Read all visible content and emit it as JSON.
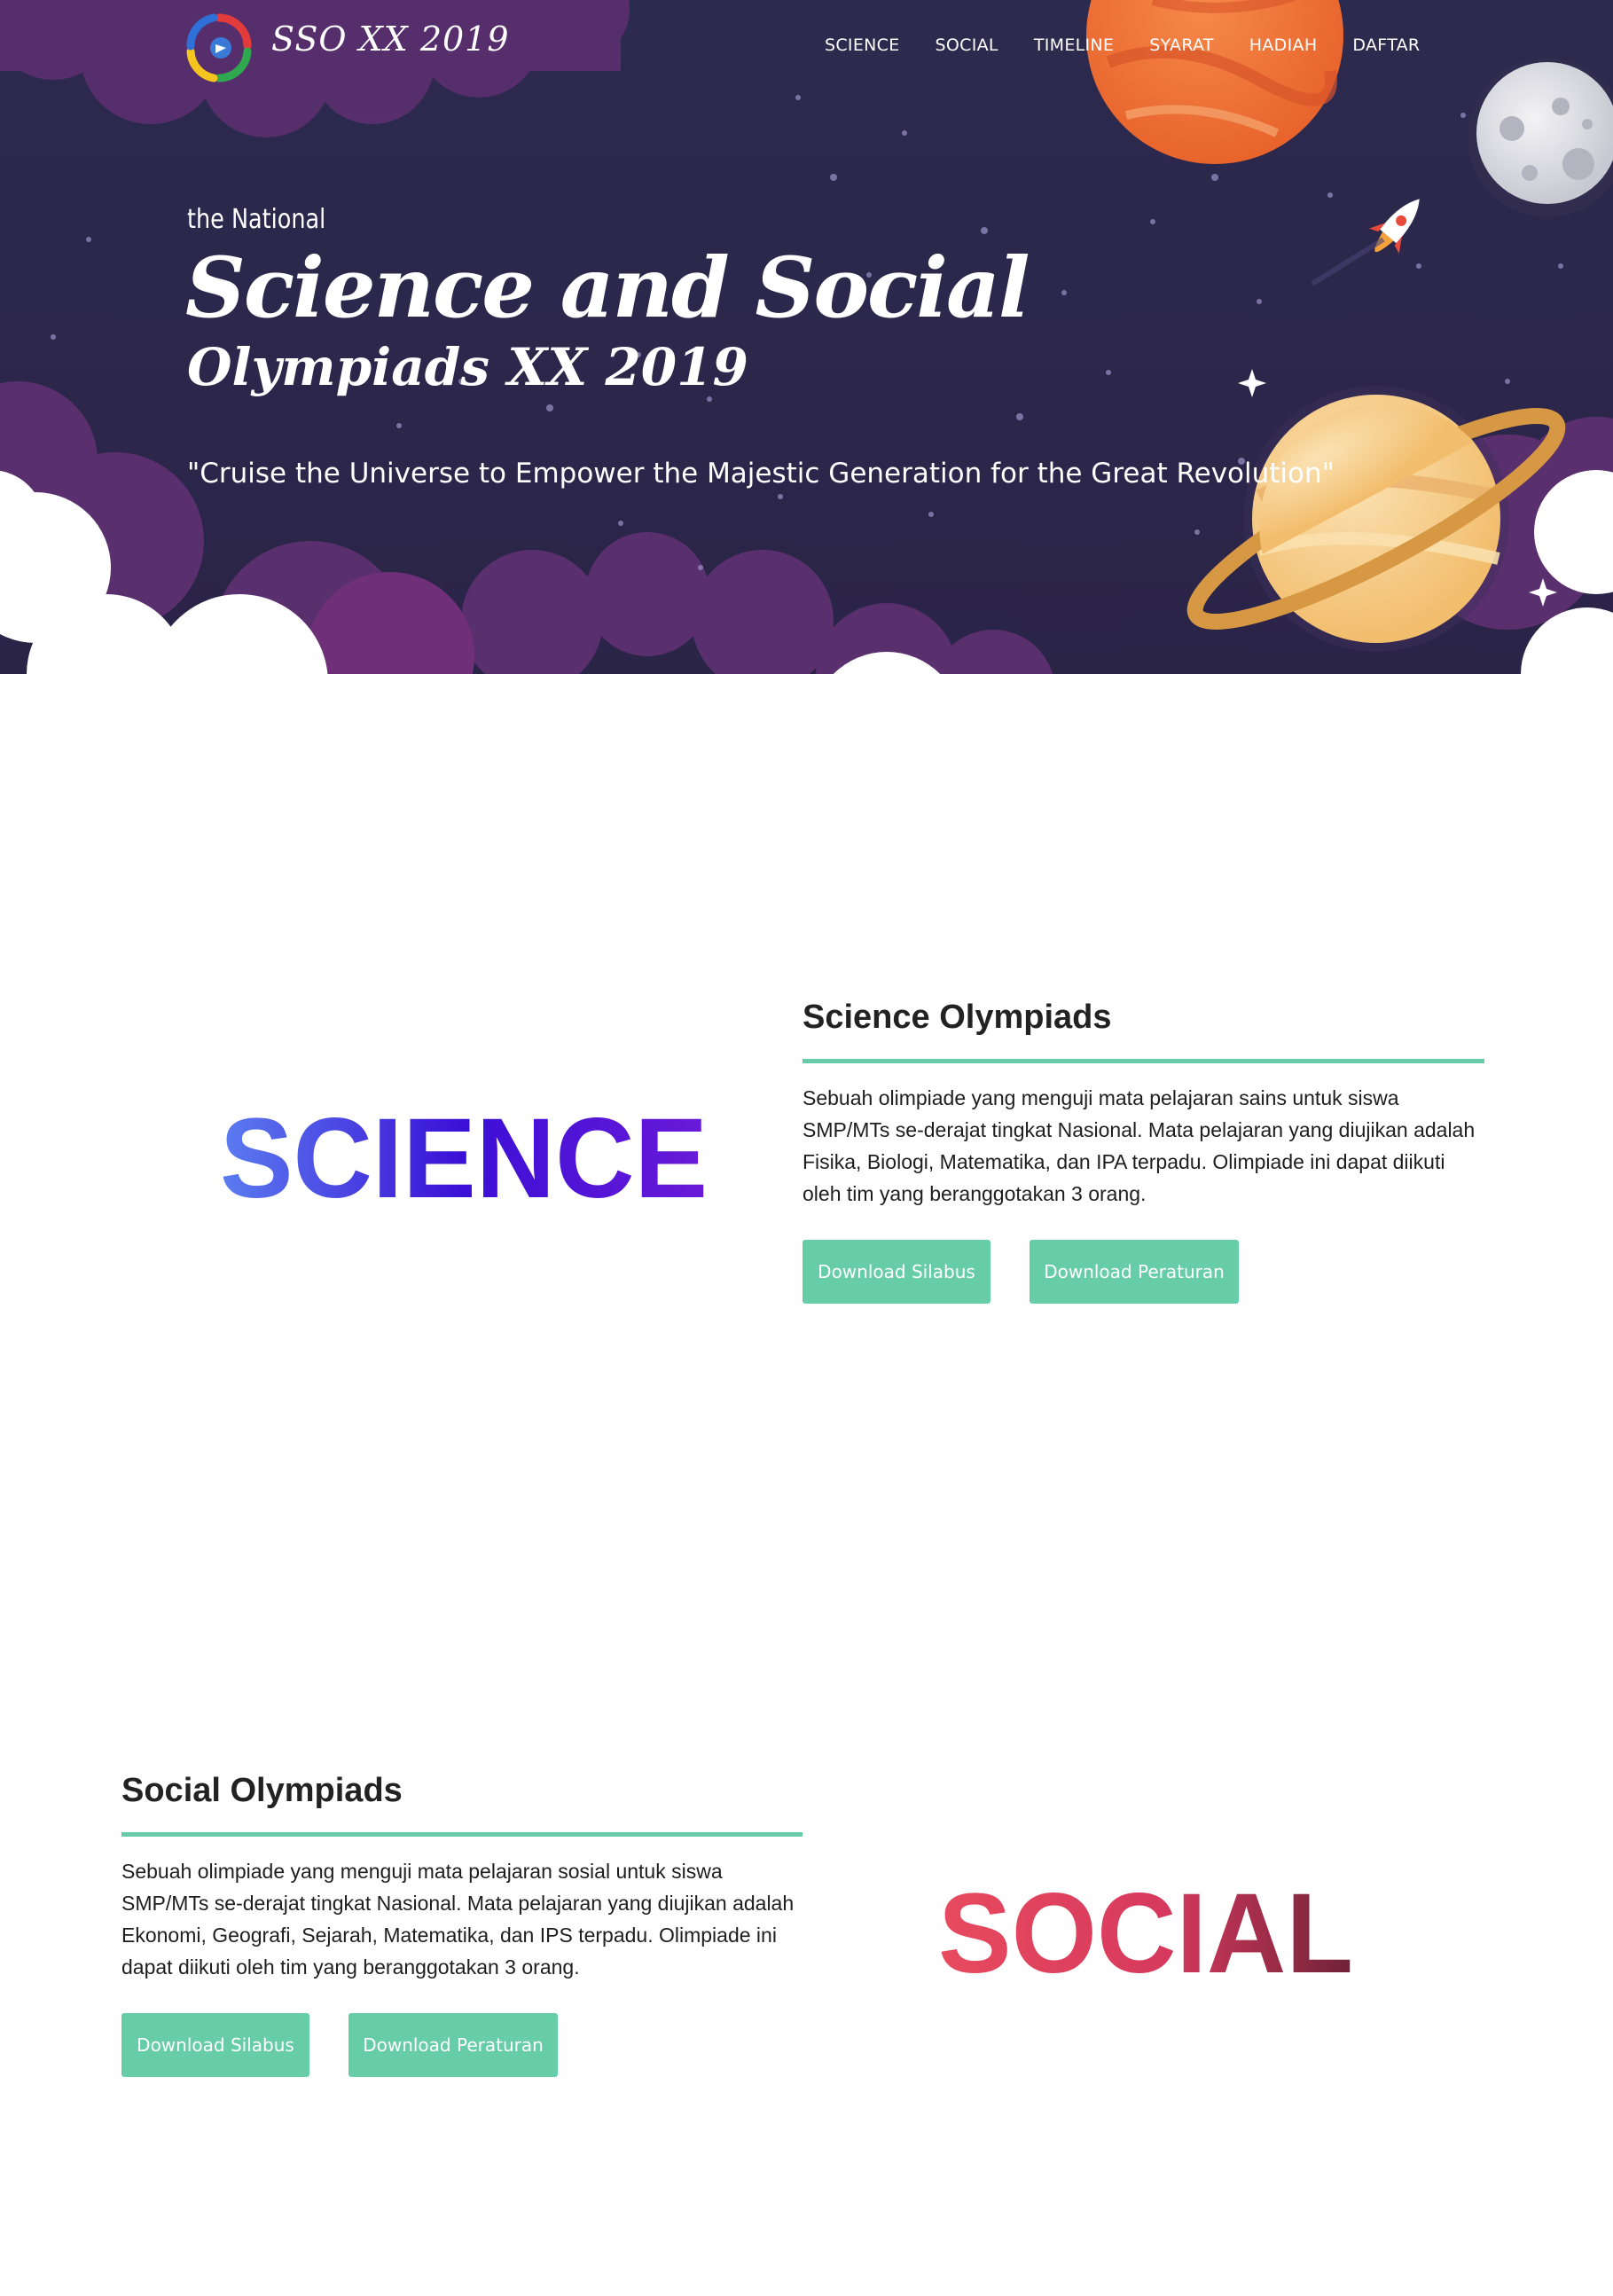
{
  "brand": {
    "name": "SSO XX 2019"
  },
  "nav": {
    "items": [
      "SCIENCE",
      "SOCIAL",
      "TIMELINE",
      "SYARAT",
      "HADIAH",
      "DAFTAR"
    ]
  },
  "hero": {
    "pre_title": "the National",
    "title": "Science and Social",
    "subtitle": "Olympiads XX 2019",
    "tagline": "\"Cruise the Universe to Empower the Majestic Generation for the Great Revolution\""
  },
  "science": {
    "word": "SCIENCE",
    "heading": "Science Olympiads",
    "description": "Sebuah olimpiade yang menguji mata pelajaran sains untuk siswa SMP/MTs se-derajat tingkat Nasional. Mata pelajaran yang diujikan adalah Fisika, Biologi, Matematika, dan IPA terpadu. Olimpiade ini dapat diikuti oleh tim yang beranggotakan 3 orang.",
    "btn_silabus": "Download Silabus",
    "btn_peraturan": "Download Peraturan"
  },
  "social": {
    "word": "SOCIAL",
    "heading": "Social Olympiads",
    "description": "Sebuah olimpiade yang menguji mata pelajaran sosial untuk siswa SMP/MTs se-derajat tingkat Nasional. Mata pelajaran yang diujikan adalah Ekonomi, Geografi, Sejarah, Matematika, dan IPS terpadu. Olimpiade ini dapat diikuti oleh tim yang beranggotakan 3 orang.",
    "btn_silabus": "Download Silabus",
    "btn_peraturan": "Download Peraturan"
  },
  "colors": {
    "accent": "#66cda8",
    "space_dark": "#2b2547",
    "science_gradient": [
      "#5b7df0",
      "#3b0fd6",
      "#6a1ad8"
    ],
    "social_gradient": [
      "#e84a5f",
      "#d6395d",
      "#6e2238"
    ]
  },
  "icons": [
    "logo-icon",
    "planet-orange-icon",
    "moon-icon",
    "rocket-icon",
    "saturn-icon",
    "sparkle-icon"
  ]
}
